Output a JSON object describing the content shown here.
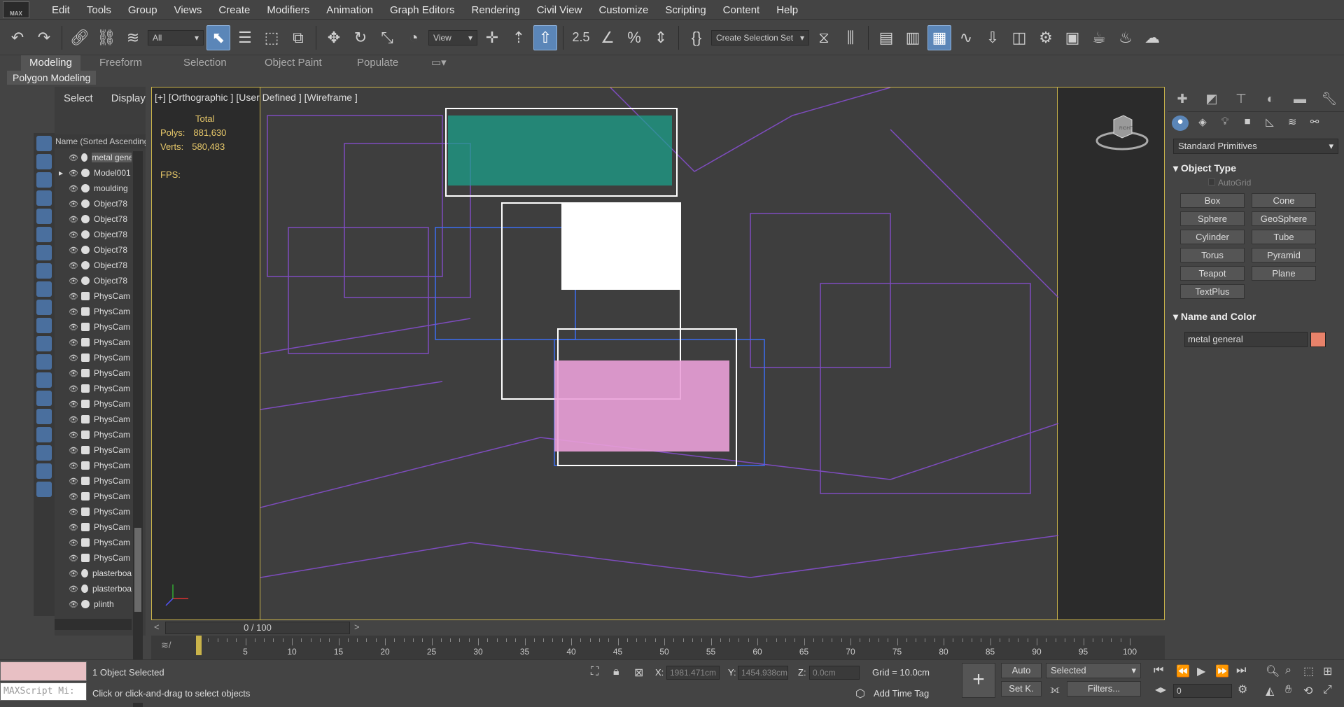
{
  "app": {
    "logo_text": "MAX"
  },
  "menu": [
    "Edit",
    "Tools",
    "Group",
    "Views",
    "Create",
    "Modifiers",
    "Animation",
    "Graph Editors",
    "Rendering",
    "Civil View",
    "Customize",
    "Scripting",
    "Content",
    "Help"
  ],
  "toolbar": {
    "filter_value": "All",
    "ref_coord_value": "View",
    "selection_set_value": "Create Selection Set",
    "snaps_label": "2.5",
    "icons": [
      "undo-icon",
      "redo-icon",
      "link-icon",
      "unlink-icon",
      "bind-space-warp-icon",
      "select-icon",
      "select-by-name-icon",
      "rect-region-icon",
      "window-crossing-icon",
      "move-icon",
      "rotate-icon",
      "scale-icon",
      "placement-icon",
      "pivot-icon",
      "manipulate-icon",
      "snap-toggle-icon",
      "angle-snap-icon",
      "percent-snap-icon",
      "spinner-snap-icon",
      "named-sets-icon",
      "mirror-icon",
      "align-icon",
      "layer-explorer-icon",
      "scene-explorer-icon",
      "ribbon-toggle-icon",
      "curve-editor-icon",
      "schematic-icon",
      "material-editor-icon",
      "render-setup-icon",
      "rendered-frame-icon",
      "render-icon",
      "render-iterative-icon",
      "cloud-render-icon"
    ]
  },
  "ribbon": {
    "tabs": [
      "Modeling",
      "Freeform",
      "Selection",
      "Object Paint",
      "Populate"
    ],
    "active_tab": "Modeling",
    "sub_label": "Polygon Modeling"
  },
  "scene_explorer": {
    "tabs": [
      "Select",
      "Display"
    ],
    "column_header": "Name (Sorted Ascending)",
    "rows": [
      {
        "name": "metal general",
        "type": "geo",
        "selected": true
      },
      {
        "name": "Model001",
        "type": "geo",
        "expand": true
      },
      {
        "name": "moulding",
        "type": "geo"
      },
      {
        "name": "Object78",
        "type": "geo"
      },
      {
        "name": "Object78",
        "type": "geo"
      },
      {
        "name": "Object78",
        "type": "geo"
      },
      {
        "name": "Object78",
        "type": "geo"
      },
      {
        "name": "Object78",
        "type": "geo"
      },
      {
        "name": "Object78",
        "type": "geo"
      },
      {
        "name": "PhysCam",
        "type": "cam"
      },
      {
        "name": "PhysCam",
        "type": "cam"
      },
      {
        "name": "PhysCam",
        "type": "cam"
      },
      {
        "name": "PhysCam",
        "type": "cam"
      },
      {
        "name": "PhysCam",
        "type": "cam"
      },
      {
        "name": "PhysCam",
        "type": "cam"
      },
      {
        "name": "PhysCam",
        "type": "cam"
      },
      {
        "name": "PhysCam",
        "type": "cam"
      },
      {
        "name": "PhysCam",
        "type": "cam"
      },
      {
        "name": "PhysCam",
        "type": "cam"
      },
      {
        "name": "PhysCam",
        "type": "cam"
      },
      {
        "name": "PhysCam",
        "type": "cam"
      },
      {
        "name": "PhysCam",
        "type": "cam"
      },
      {
        "name": "PhysCam",
        "type": "cam"
      },
      {
        "name": "PhysCam",
        "type": "cam"
      },
      {
        "name": "PhysCam",
        "type": "cam"
      },
      {
        "name": "PhysCam",
        "type": "cam"
      },
      {
        "name": "PhysCam",
        "type": "cam"
      },
      {
        "name": "plasterboard",
        "type": "geo"
      },
      {
        "name": "plasterboard",
        "type": "geo"
      },
      {
        "name": "plinth",
        "type": "geo"
      }
    ]
  },
  "viewport": {
    "label": "[+] [Orthographic ] [User Defined ] [Wireframe ]",
    "stats_header": "Total",
    "polys_label": "Polys:",
    "polys_value": "881,630",
    "verts_label": "Verts:",
    "verts_value": "580,483",
    "fps_label": "FPS:",
    "viewcube_label": "RIGHT"
  },
  "command_panel": {
    "tab_icons": [
      "create-icon",
      "modify-icon",
      "hierarchy-icon",
      "motion-icon",
      "display-icon",
      "utilities-icon"
    ],
    "sub_icons": [
      "geometry-icon",
      "shapes-icon",
      "lights-icon",
      "cameras-icon",
      "helpers-icon",
      "space-warps-icon",
      "systems-icon"
    ],
    "category": "Standard Primitives",
    "object_type_title": "Object Type",
    "autogrid_label": "AutoGrid",
    "buttons": [
      "Box",
      "Cone",
      "Sphere",
      "GeoSphere",
      "Cylinder",
      "Tube",
      "Torus",
      "Pyramid",
      "Teapot",
      "Plane",
      "TextPlus"
    ],
    "name_color_title": "Name and Color",
    "object_name": "metal general",
    "object_color": "#e8826a"
  },
  "timeline": {
    "frame_label": "0 / 100",
    "current_frame": 0,
    "max_frame": 100,
    "tick_labels": [
      "0",
      "5",
      "10",
      "15",
      "20",
      "25",
      "30",
      "35",
      "40",
      "45",
      "50",
      "55",
      "60",
      "65",
      "70",
      "75",
      "80",
      "85",
      "90",
      "95",
      "100"
    ]
  },
  "status": {
    "selection_text": "1 Object Selected",
    "prompt_text": "Click or click-and-drag to select objects",
    "maxscript_label": "MAXScript Mi:",
    "x_label": "X:",
    "x_value": "1981.471cm",
    "y_label": "Y:",
    "y_value": "1454.938cm",
    "z_label": "Z:",
    "z_value": "0.0cm",
    "grid_text": "Grid = 10.0cm",
    "add_time_tag": "Add Time Tag",
    "auto_label": "Auto",
    "setkey_label": "Set K.",
    "key_mode_value": "Selected",
    "filters_label": "Filters...",
    "frame_field": "0"
  }
}
